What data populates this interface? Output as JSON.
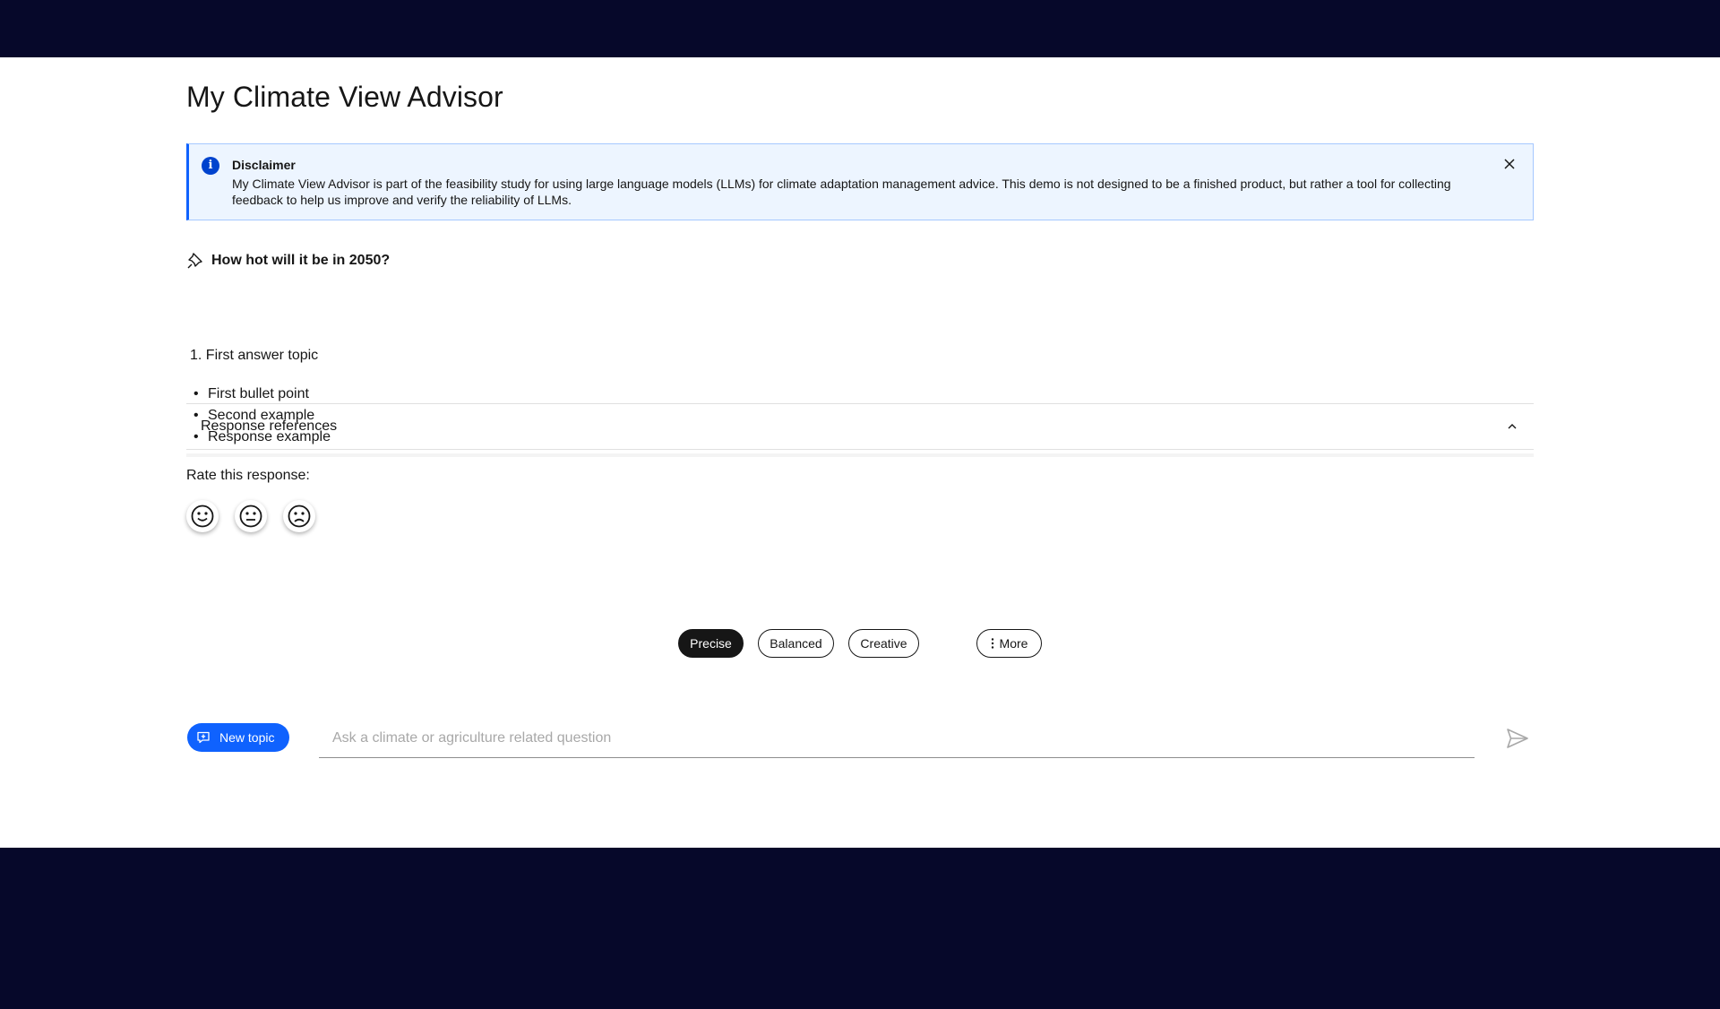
{
  "app": {
    "title": "My Climate View Advisor"
  },
  "disclaimer": {
    "title": "Disclaimer",
    "text": "My Climate View Advisor is part of the feasibility study for using large language models (LLMs) for climate adaptation management advice. This demo is not designed to be a finished product, but rather a tool for collecting feedback to help us improve and verify the reliability of LLMs.",
    "icon": "info-icon",
    "close_icon": "close-icon"
  },
  "question": {
    "text": "How hot will it be in 2050?",
    "icon": "pin-icon"
  },
  "answer": {
    "ordered": [
      {
        "num": "1.",
        "text": "First answer topic"
      }
    ],
    "bullets": [
      "First bullet point",
      "Second example",
      "Response example"
    ]
  },
  "references": {
    "label": "Response references",
    "icon": "chevron-up-icon"
  },
  "rating": {
    "label": "Rate this response:",
    "options": [
      "happy-face-icon",
      "neutral-face-icon",
      "sad-face-icon"
    ]
  },
  "modes": {
    "options": [
      "Precise",
      "Balanced",
      "Creative"
    ],
    "selected": "Precise",
    "more_label": "More"
  },
  "composer": {
    "new_topic_label": "New topic",
    "placeholder": "Ask a climate or agriculture related question",
    "value": "",
    "send_icon": "send-icon"
  },
  "colors": {
    "background_dark": "#06082a",
    "accent": "#0f62fe",
    "notice_bg": "#edf5ff"
  }
}
